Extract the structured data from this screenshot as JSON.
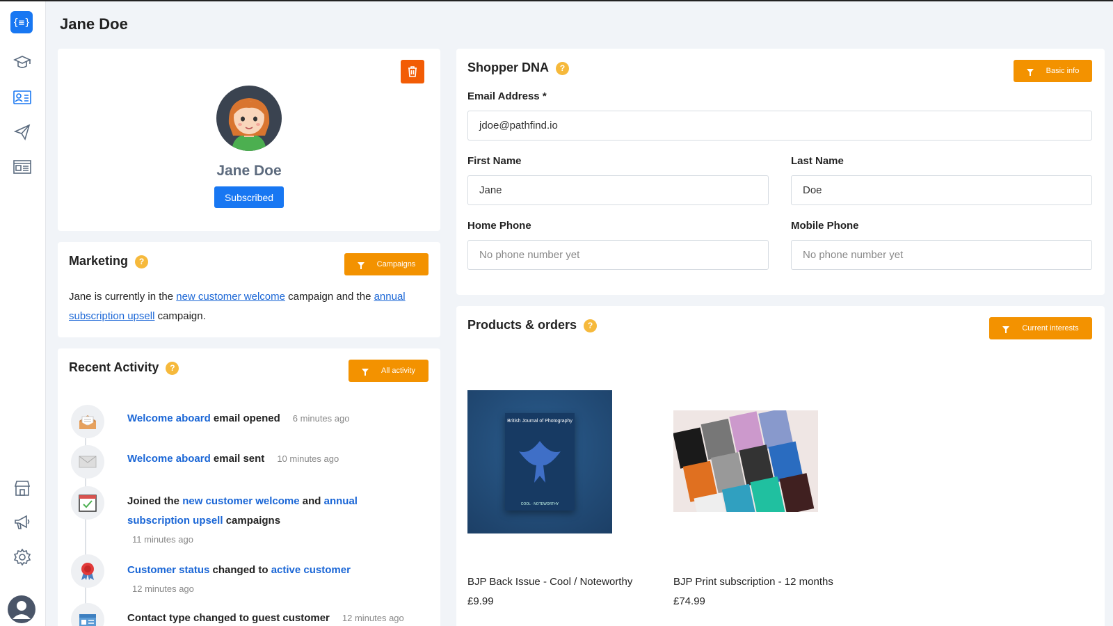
{
  "page": {
    "title": "Jane Doe"
  },
  "sidebar": {
    "items": [
      {
        "icon": "logo-icon"
      },
      {
        "icon": "graduation-cap-icon"
      },
      {
        "icon": "contact-card-icon"
      },
      {
        "icon": "paper-plane-icon"
      },
      {
        "icon": "newspaper-icon"
      },
      {
        "icon": "store-icon"
      },
      {
        "icon": "megaphone-icon"
      },
      {
        "icon": "gear-icon"
      },
      {
        "icon": "user-avatar-icon"
      }
    ],
    "active_color": "#1877f2"
  },
  "profile": {
    "name": "Jane Doe",
    "status": "Subscribed",
    "delete_icon": "trash-icon"
  },
  "marketing": {
    "title": "Marketing",
    "help": "?",
    "button": "Campaigns",
    "text_1": "Jane is currently in the ",
    "link_1": "new customer welcome",
    "text_2": " campaign and the ",
    "link_2": "annual subscription upsell",
    "text_3": " campaign."
  },
  "activity": {
    "title": "Recent Activity",
    "help": "?",
    "button": "All activity",
    "items": [
      {
        "icon": "open-envelope-icon",
        "link": "Welcome aboard",
        "text": " email opened",
        "time": "6 minutes ago"
      },
      {
        "icon": "envelope-icon",
        "link": "Welcome aboard",
        "text": " email sent",
        "time": "10 minutes ago"
      },
      {
        "icon": "calendar-check-icon",
        "text_a": "Joined the ",
        "link_a": "new customer welcome",
        "text_b": " and ",
        "link_b": "annual subscription upsell",
        "text_c": " campaigns",
        "time": "11 minutes ago"
      },
      {
        "icon": "award-ribbon-icon",
        "link_a": "Customer status",
        "text_b": " changed to ",
        "link_b": "active customer",
        "time": "12 minutes ago"
      },
      {
        "icon": "contact-type-icon",
        "text": "Contact type changed to guest customer",
        "time": "12 minutes ago"
      }
    ]
  },
  "shopper_dna": {
    "title": "Shopper DNA",
    "help": "?",
    "button": "Basic info",
    "email_label": "Email Address *",
    "email_value": "jdoe@pathfind.io",
    "first_name_label": "First Name",
    "first_name_value": "Jane",
    "last_name_label": "Last Name",
    "last_name_value": "Doe",
    "home_phone_label": "Home Phone",
    "home_phone_placeholder": "No phone number yet",
    "mobile_phone_label": "Mobile Phone",
    "mobile_phone_placeholder": "No phone number yet"
  },
  "products": {
    "title": "Products & orders",
    "help": "?",
    "button": "Current interests",
    "items": [
      {
        "name": "BJP Back Issue - Cool / Noteworthy",
        "price": "£9.99",
        "cover_title": "British Journal of Photography",
        "cover_footer": "COOL · NOTEWORTHY"
      },
      {
        "name": "BJP Print subscription - 12 months",
        "price": "£74.99"
      }
    ]
  },
  "colors": {
    "accent": "#1877f2",
    "orange": "#f39200",
    "link": "#1a66d6",
    "help": "#f6b93b",
    "delete": "#f25c05"
  }
}
